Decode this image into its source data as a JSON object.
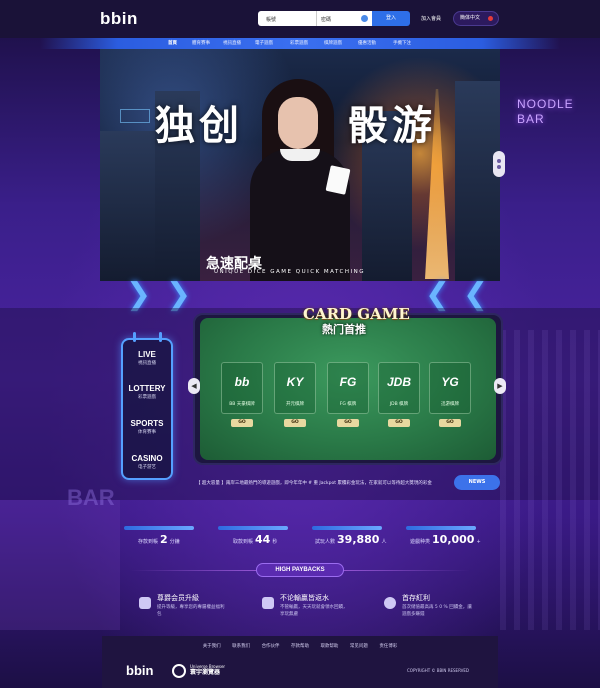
{
  "header": {
    "logo": "bbin",
    "account_placeholder": "帳號",
    "password_placeholder": "密碼",
    "login_label": "登入",
    "join_label": "加入會員",
    "language_label": "簡体中文"
  },
  "nav": {
    "items": [
      {
        "label": "首頁",
        "active": true
      },
      {
        "label": "體育賽事",
        "active": false
      },
      {
        "label": "視訊直播",
        "active": false
      },
      {
        "label": "電子遊戲",
        "active": false
      },
      {
        "label": "彩票遊戲",
        "active": false
      },
      {
        "label": "棋牌遊戲",
        "active": false
      },
      {
        "label": "優惠活動",
        "active": false
      },
      {
        "label": "手機下注",
        "active": false
      }
    ]
  },
  "hero": {
    "title_left": "独创",
    "title_right": "骰游",
    "subtitle": "急速配桌",
    "tagline": "UNIQUE DICE GAME QUICK MATCHING",
    "neon_sign": "NOODLE BAR"
  },
  "side_menu": [
    {
      "title": "LIVE",
      "subtitle": "視訊直播"
    },
    {
      "title": "LOTTERY",
      "subtitle": "彩票遊戲"
    },
    {
      "title": "SPORTS",
      "subtitle": "体育賽事"
    },
    {
      "title": "CASINO",
      "subtitle": "电子游艺"
    }
  ],
  "card_game": {
    "title": "CARD GAME",
    "subtitle": "熱门首推",
    "games": [
      {
        "brand": "bb",
        "name": "BB 天豪棋牌",
        "go": "GO"
      },
      {
        "brand": "KY",
        "name": "开元棋牌",
        "go": "GO"
      },
      {
        "brand": "FG",
        "name": "FG 棋牌",
        "go": "GO"
      },
      {
        "brand": "JDB",
        "name": "JDB 棋牌",
        "go": "GO"
      },
      {
        "brand": "YG",
        "name": "迅游棋牌",
        "go": "GO"
      }
    ]
  },
  "news": {
    "text": "【 超大容量 】兩岸三地最熱門的導遊遊戲，即今年年中 # 重 Jackpot 累積彩金玩法，在家就可以等待超大獎現的彩金",
    "button": "NEWS"
  },
  "stats": [
    {
      "label": "存款到帳",
      "value": "2",
      "unit": "分鐘"
    },
    {
      "label": "取款到帳",
      "value": "44",
      "unit": "秒"
    },
    {
      "label": "試玩人數",
      "value": "39,880",
      "unit": "人"
    },
    {
      "label": "遊戲种类",
      "value": "10,000",
      "unit": "+"
    }
  ],
  "high_paybacks": {
    "label": "HIGH PAYBACKS",
    "features": [
      {
        "title": "尊爵会员升級",
        "desc": "提升等級，專享您的專屬權益福利包",
        "icon": "crown-icon"
      },
      {
        "title": "不论輸贏皆返水",
        "desc": "不管輸贏，天天玩就會領水回饋，享玩無慮",
        "icon": "trophy-icon"
      },
      {
        "title": "首存紅利",
        "desc": "首次储值最高再 5 0 % 回饋金，讓遊戲多賺錢",
        "icon": "coin-icon"
      }
    ]
  },
  "footer": {
    "links": [
      "关于我们",
      "联系我们",
      "合作伙伴",
      "存款帮助",
      "取款帮助",
      "常见问题",
      "责任博彩"
    ],
    "logo": "bbin",
    "browser_name": "Universe Browser",
    "browser_cn": "寰宇瀏覽器",
    "copyright": "COPYRIGHT © BBIN RESERVED"
  }
}
